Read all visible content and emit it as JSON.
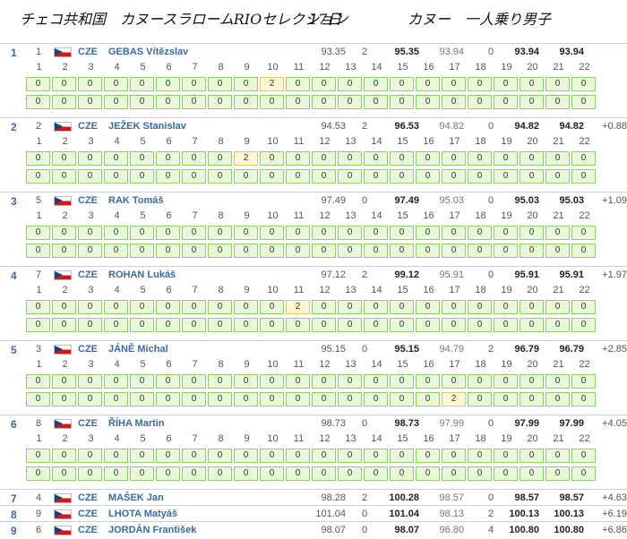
{
  "title": {
    "left": "チェコ共和国　カヌースラロームRIOセレクション",
    "day": "17日",
    "right": "カヌー　一人乗り男子"
  },
  "gate_numbers": [
    "1",
    "2",
    "3",
    "4",
    "5",
    "6",
    "7",
    "8",
    "9",
    "10",
    "11",
    "12",
    "13",
    "14",
    "15",
    "16",
    "17",
    "18",
    "19",
    "20",
    "21",
    "22"
  ],
  "athletes": [
    {
      "rank": "1",
      "bib": "1",
      "nat": "CZE",
      "name": "GEBAS Vítězslav",
      "run1_time": "93.35",
      "run1_pen": "2",
      "run1_total": "95.35",
      "run2_time": "93.94",
      "run2_pen": "0",
      "run2_total": "93.94",
      "best": "93.94",
      "behind": "",
      "run1_gates": [
        "0",
        "0",
        "0",
        "0",
        "0",
        "0",
        "0",
        "0",
        "0",
        "2",
        "0",
        "0",
        "0",
        "0",
        "0",
        "0",
        "0",
        "0",
        "0",
        "0",
        "0",
        "0"
      ],
      "run2_gates": [
        "0",
        "0",
        "0",
        "0",
        "0",
        "0",
        "0",
        "0",
        "0",
        "0",
        "0",
        "0",
        "0",
        "0",
        "0",
        "0",
        "0",
        "0",
        "0",
        "0",
        "0",
        "0"
      ]
    },
    {
      "rank": "2",
      "bib": "2",
      "nat": "CZE",
      "name": "JEŽEK Stanislav",
      "run1_time": "94.53",
      "run1_pen": "2",
      "run1_total": "96.53",
      "run2_time": "94.82",
      "run2_pen": "0",
      "run2_total": "94.82",
      "best": "94.82",
      "behind": "+0.88",
      "run1_gates": [
        "0",
        "0",
        "0",
        "0",
        "0",
        "0",
        "0",
        "0",
        "2",
        "0",
        "0",
        "0",
        "0",
        "0",
        "0",
        "0",
        "0",
        "0",
        "0",
        "0",
        "0",
        "0"
      ],
      "run2_gates": [
        "0",
        "0",
        "0",
        "0",
        "0",
        "0",
        "0",
        "0",
        "0",
        "0",
        "0",
        "0",
        "0",
        "0",
        "0",
        "0",
        "0",
        "0",
        "0",
        "0",
        "0",
        "0"
      ]
    },
    {
      "rank": "3",
      "bib": "5",
      "nat": "CZE",
      "name": "RAK Tomáš",
      "run1_time": "97.49",
      "run1_pen": "0",
      "run1_total": "97.49",
      "run2_time": "95.03",
      "run2_pen": "0",
      "run2_total": "95.03",
      "best": "95.03",
      "behind": "+1.09",
      "run1_gates": [
        "0",
        "0",
        "0",
        "0",
        "0",
        "0",
        "0",
        "0",
        "0",
        "0",
        "0",
        "0",
        "0",
        "0",
        "0",
        "0",
        "0",
        "0",
        "0",
        "0",
        "0",
        "0"
      ],
      "run2_gates": [
        "0",
        "0",
        "0",
        "0",
        "0",
        "0",
        "0",
        "0",
        "0",
        "0",
        "0",
        "0",
        "0",
        "0",
        "0",
        "0",
        "0",
        "0",
        "0",
        "0",
        "0",
        "0"
      ]
    },
    {
      "rank": "4",
      "bib": "7",
      "nat": "CZE",
      "name": "ROHAN Lukáš",
      "run1_time": "97.12",
      "run1_pen": "2",
      "run1_total": "99.12",
      "run2_time": "95.91",
      "run2_pen": "0",
      "run2_total": "95.91",
      "best": "95.91",
      "behind": "+1.97",
      "run1_gates": [
        "0",
        "0",
        "0",
        "0",
        "0",
        "0",
        "0",
        "0",
        "0",
        "0",
        "2",
        "0",
        "0",
        "0",
        "0",
        "0",
        "0",
        "0",
        "0",
        "0",
        "0",
        "0"
      ],
      "run2_gates": [
        "0",
        "0",
        "0",
        "0",
        "0",
        "0",
        "0",
        "0",
        "0",
        "0",
        "0",
        "0",
        "0",
        "0",
        "0",
        "0",
        "0",
        "0",
        "0",
        "0",
        "0",
        "0"
      ]
    },
    {
      "rank": "5",
      "bib": "3",
      "nat": "CZE",
      "name": "JÁNĚ Michal",
      "run1_time": "95.15",
      "run1_pen": "0",
      "run1_total": "95.15",
      "run2_time": "94.79",
      "run2_pen": "2",
      "run2_total": "96.79",
      "best": "96.79",
      "behind": "+2.85",
      "run1_gates": [
        "0",
        "0",
        "0",
        "0",
        "0",
        "0",
        "0",
        "0",
        "0",
        "0",
        "0",
        "0",
        "0",
        "0",
        "0",
        "0",
        "0",
        "0",
        "0",
        "0",
        "0",
        "0"
      ],
      "run2_gates": [
        "0",
        "0",
        "0",
        "0",
        "0",
        "0",
        "0",
        "0",
        "0",
        "0",
        "0",
        "0",
        "0",
        "0",
        "0",
        "0",
        "2",
        "0",
        "0",
        "0",
        "0",
        "0"
      ]
    },
    {
      "rank": "6",
      "bib": "8",
      "nat": "CZE",
      "name": "ŘÍHA Martin",
      "run1_time": "98.73",
      "run1_pen": "0",
      "run1_total": "98.73",
      "run2_time": "97.99",
      "run2_pen": "0",
      "run2_total": "97.99",
      "best": "97.99",
      "behind": "+4.05",
      "run1_gates": [
        "0",
        "0",
        "0",
        "0",
        "0",
        "0",
        "0",
        "0",
        "0",
        "0",
        "0",
        "0",
        "0",
        "0",
        "0",
        "0",
        "0",
        "0",
        "0",
        "0",
        "0",
        "0"
      ],
      "run2_gates": [
        "0",
        "0",
        "0",
        "0",
        "0",
        "0",
        "0",
        "0",
        "0",
        "0",
        "0",
        "0",
        "0",
        "0",
        "0",
        "0",
        "0",
        "0",
        "0",
        "0",
        "0",
        "0"
      ]
    },
    {
      "rank": "7",
      "bib": "4",
      "nat": "CZE",
      "name": "MAŠEK Jan",
      "run1_time": "98.28",
      "run1_pen": "2",
      "run1_total": "100.28",
      "run2_time": "98.57",
      "run2_pen": "0",
      "run2_total": "98.57",
      "best": "98.57",
      "behind": "+4.63"
    },
    {
      "rank": "8",
      "bib": "9",
      "nat": "CZE",
      "name": "LHOTA Matyáš",
      "run1_time": "101.04",
      "run1_pen": "0",
      "run1_total": "101.04",
      "run2_time": "98.13",
      "run2_pen": "2",
      "run2_total": "100.13",
      "best": "100.13",
      "behind": "+6.19"
    },
    {
      "rank": "9",
      "bib": "6",
      "nat": "CZE",
      "name": "JORDÁN František",
      "run1_time": "98.07",
      "run1_pen": "0",
      "run1_total": "98.07",
      "run2_time": "96.80",
      "run2_pen": "4",
      "run2_total": "100.80",
      "best": "100.80",
      "behind": "+6.86"
    }
  ],
  "colors": {
    "link_blue": "#3b6aa0",
    "gate_cell_bg": "#e9f8d8",
    "gate_cell_border": "#8ccf67",
    "penalty_cell_bg": "#fff7d2"
  }
}
